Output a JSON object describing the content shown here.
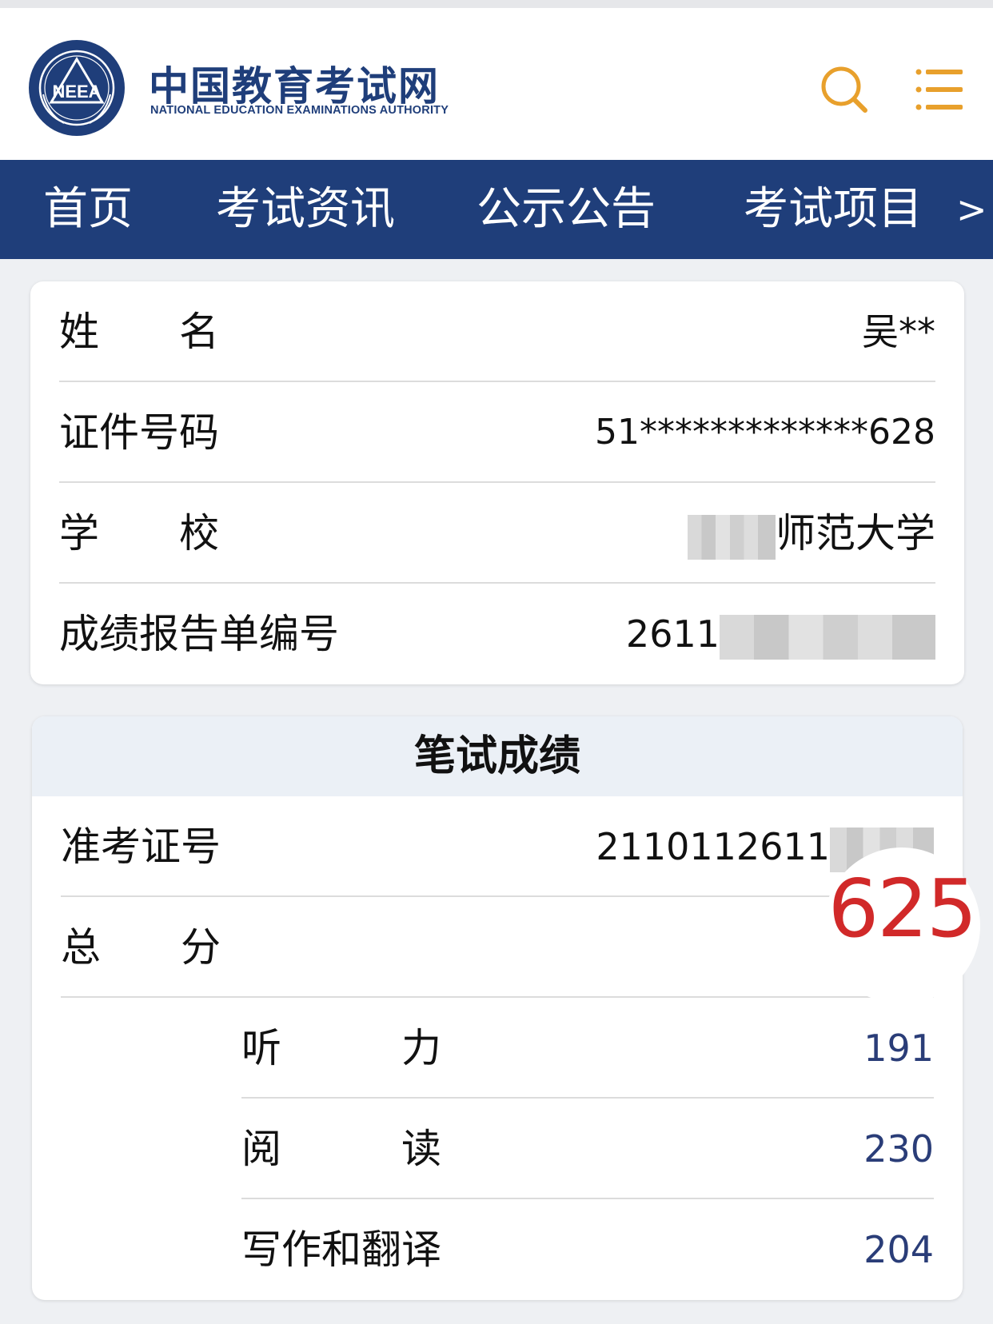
{
  "header": {
    "logo_text": "NEEA",
    "site_title": "中国教育考试网",
    "site_subtitle": "NATIONAL EDUCATION EXAMINATIONS AUTHORITY",
    "search_icon": "search-icon",
    "menu_icon": "menu-icon",
    "accent_color": "#e8a02c",
    "brand_color": "#1f3e7a"
  },
  "nav": {
    "items": [
      "首页",
      "考试资讯",
      "公示公告",
      "考试项目"
    ],
    "more_arrow": ">"
  },
  "candidate": {
    "name_label": "姓　　名",
    "name_value": "吴**",
    "id_label": "证件号码",
    "id_value": "51*************628",
    "school_label": "学　　校",
    "school_value": "师范大学",
    "report_label": "成绩报告单编号",
    "report_value": "2611"
  },
  "written": {
    "title": "笔试成绩",
    "ticket_label": "准考证号",
    "ticket_value": "2110112611",
    "total_label": "总　　分",
    "total_value": "625",
    "listening_label": "听　　　力",
    "listening_value": "191",
    "reading_label": "阅　　　读",
    "reading_value": "230",
    "writing_label": "写作和翻译",
    "writing_value": "204"
  }
}
